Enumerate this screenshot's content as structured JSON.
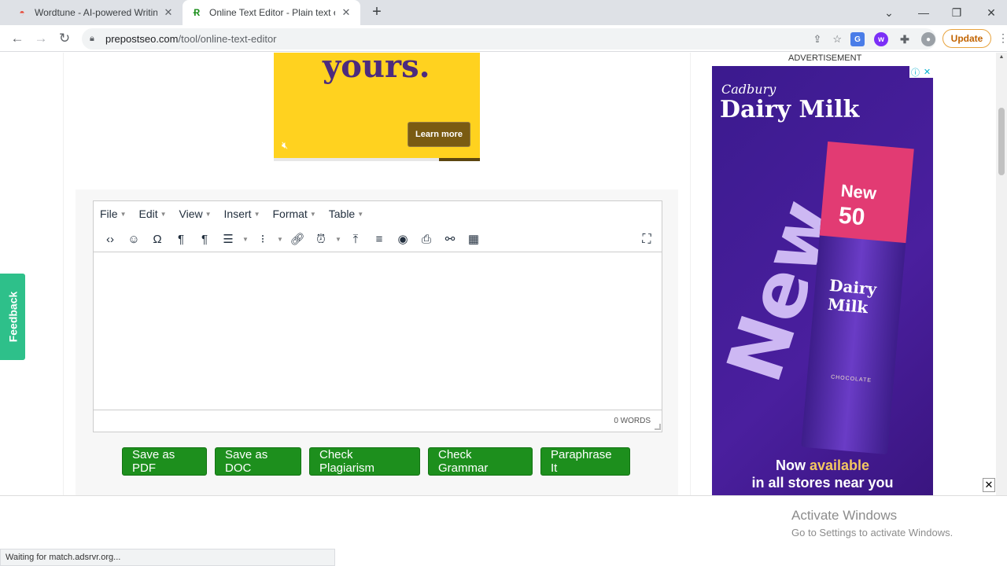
{
  "tabs": [
    {
      "title": "Wordtune - AI-powered Writing",
      "favicon": "wordtune-icon"
    },
    {
      "title": "Online Text Editor - Plain text ed",
      "favicon": "prepostseo-icon"
    }
  ],
  "address": {
    "host": "prepostseo.com",
    "path": "/tool/online-text-editor"
  },
  "browser": {
    "update_label": "Update"
  },
  "ad_top": {
    "headline": "yours.",
    "cta": "Learn more"
  },
  "editor": {
    "menus": [
      "File",
      "Edit",
      "View",
      "Insert",
      "Format",
      "Table"
    ],
    "word_count": "0 WORDS"
  },
  "actions": [
    "Save as PDF",
    "Save as DOC",
    "Check Plagiarism",
    "Check Grammar",
    "Paraphrase It"
  ],
  "feedback": {
    "label": "Feedback"
  },
  "ad_right": {
    "label": "ADVERTISEMENT",
    "brand_small": "Cadbury",
    "brand": "Dairy Milk",
    "new_big": "New",
    "bar_new": "New",
    "bar_price": "50",
    "bar_brand": "Dairy Milk",
    "bar_choc": "CHOCOLATE",
    "now": "Now",
    "available": "available",
    "stores": "in all stores near you"
  },
  "windows": {
    "line1": "Activate Windows",
    "line2": "Go to Settings to activate Windows."
  },
  "status": {
    "text": "Waiting for match.adsrvr.org..."
  },
  "colors": {
    "green": "#1d8f1d",
    "feedback": "#2ec08a",
    "ad_purple": "#3b1a8e",
    "ad_yellow": "#ffd21f"
  }
}
